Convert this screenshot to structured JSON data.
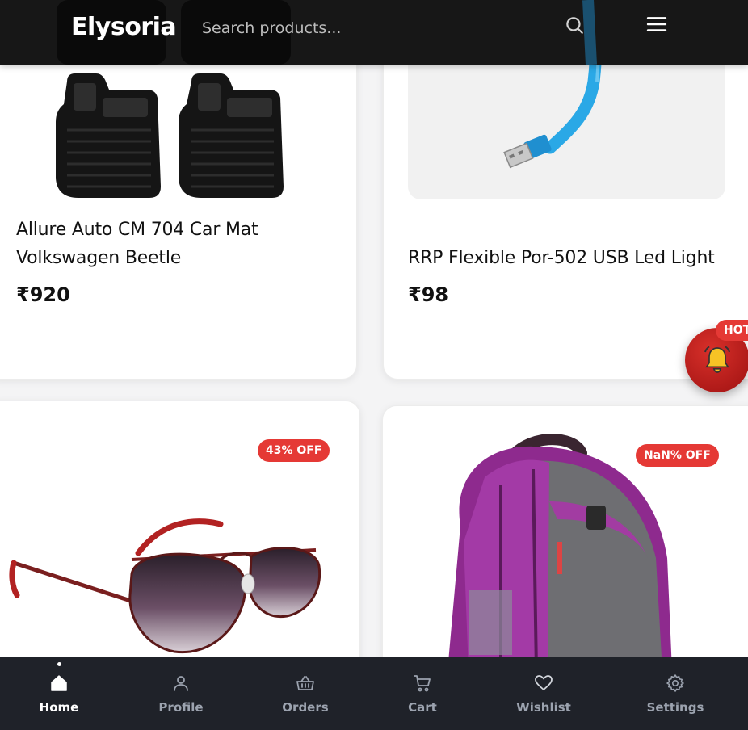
{
  "header": {
    "brand": "Elysoria",
    "search_placeholder": "Search products..."
  },
  "products": [
    {
      "title_line1": "Allure Auto CM 704 Car Mat",
      "title_line2": "Volkswagen Beetle",
      "price": "₹920",
      "image": "car-mat"
    },
    {
      "title_line1": "RRP Flexible Por-502 USB Led Light",
      "price": "₹98",
      "image": "usb-led-light"
    },
    {
      "badge": "43% OFF",
      "image": "aviator-sunglasses"
    },
    {
      "badge": "NaN% OFF",
      "image": "purple-backpack"
    }
  ],
  "floating": {
    "badge": "HOT",
    "icon": "bell-icon"
  },
  "bottom_nav": [
    {
      "label": "Home",
      "icon": "home-icon",
      "active": true
    },
    {
      "label": "Profile",
      "icon": "user-icon"
    },
    {
      "label": "Orders",
      "icon": "basket-icon"
    },
    {
      "label": "Cart",
      "icon": "cart-icon"
    },
    {
      "label": "Wishlist",
      "icon": "heart-icon"
    },
    {
      "label": "Settings",
      "icon": "gear-icon"
    }
  ],
  "colors": {
    "header_bg": "#171717",
    "nav_bg": "#1f2229",
    "badge": "#e53935",
    "fab": "#c62828"
  }
}
